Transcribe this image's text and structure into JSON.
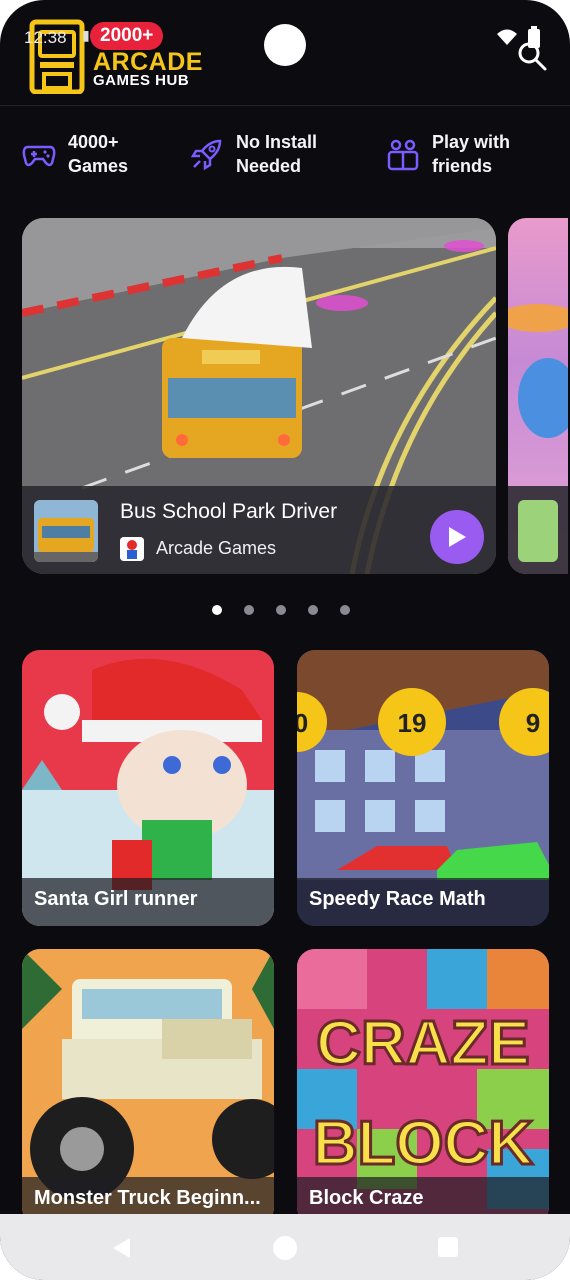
{
  "status_bar": {
    "time": "12:38",
    "icons": [
      "sim-icon",
      "heart-icon",
      "heart-icon",
      "bag-icon",
      "wifi-icon",
      "battery-icon"
    ]
  },
  "header": {
    "badge": "2000+",
    "logo_line1": "ARCADE",
    "logo_line2": "GAMES HUB",
    "search_icon": "search-icon"
  },
  "features": [
    {
      "label": "4000+\nGames",
      "icon": "gamepad-icon"
    },
    {
      "label": "No Install\nNeeded",
      "icon": "rocket-icon"
    },
    {
      "label": "Play with\nfriends",
      "icon": "friends-icon"
    }
  ],
  "carousel": {
    "featured": {
      "title": "Bus School Park Driver",
      "category": "Arcade Games"
    },
    "page_count": 5,
    "active_page": 1
  },
  "games": [
    {
      "title": "Santa Girl runner"
    },
    {
      "title": "Speedy Race Math"
    },
    {
      "title": "Monster Truck Beginn..."
    },
    {
      "title": "Block Craze"
    }
  ],
  "colors": {
    "background": "#0b0b10",
    "accent": "#9a5cf0",
    "feature_icon": "#7b5cff",
    "badge": "#e8223b",
    "logo_yellow": "#f5c518"
  }
}
